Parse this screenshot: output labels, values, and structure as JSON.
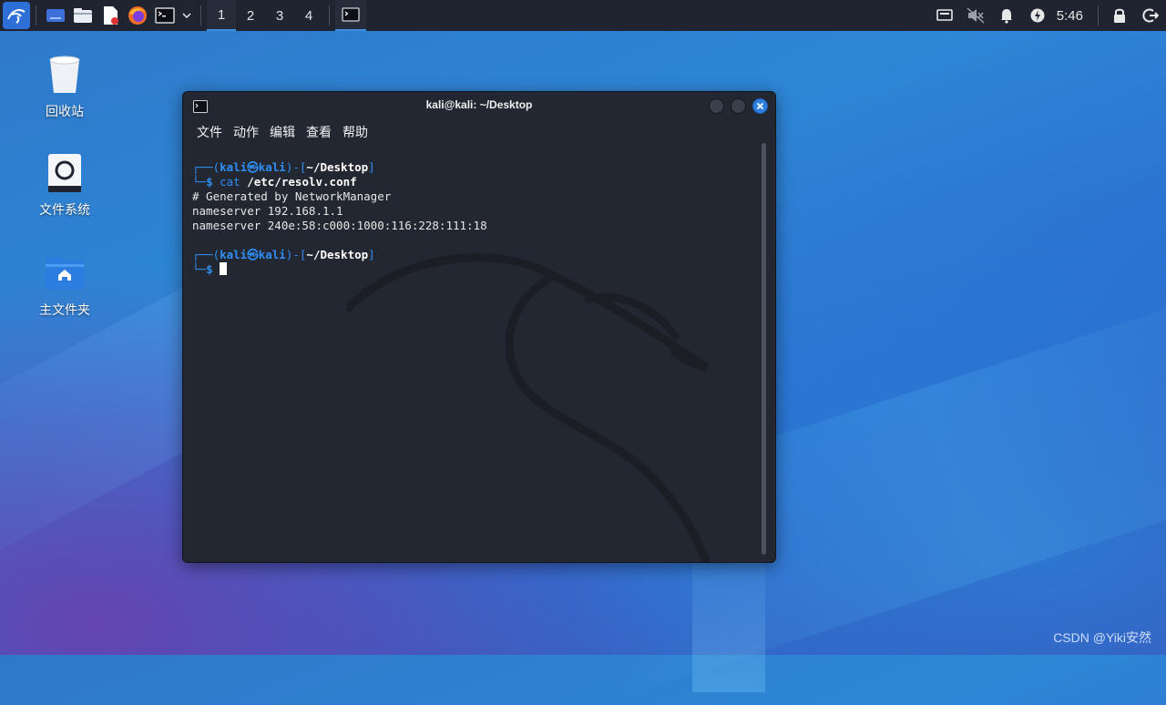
{
  "taskbar": {
    "workspaces": [
      "1",
      "2",
      "3",
      "4"
    ],
    "active_workspace": "1",
    "clock": "5:46",
    "icons": [
      "kali-menu-icon",
      "show-desktop-icon",
      "file-manager-icon",
      "text-editor-icon",
      "firefox-icon",
      "terminal-icon",
      "chevron-down-icon",
      "network-icon",
      "mute-icon",
      "bell-icon",
      "power-icon",
      "lock-icon",
      "logout-icon"
    ]
  },
  "desktop": {
    "icons": [
      {
        "label": "回收站",
        "icon": "trash-icon"
      },
      {
        "label": "文件系统",
        "icon": "drive-icon"
      },
      {
        "label": "主文件夹",
        "icon": "home-folder-icon"
      }
    ]
  },
  "terminal": {
    "title": "kali@kali: ~/Desktop",
    "menu": [
      "文件",
      "动作",
      "编辑",
      "查看",
      "帮助"
    ],
    "prompt1": {
      "open": "┌──(",
      "user": "kali",
      "at": "㉿",
      "host": "kali",
      "mid": ")-[",
      "path": "~/Desktop",
      "close": "]"
    },
    "prompt1_line2": {
      "corner": "└─",
      "dollar": "$",
      "cmd": "cat",
      "arg": "/etc/resolv.conf"
    },
    "output": [
      "# Generated by NetworkManager",
      "nameserver 192.168.1.1",
      "nameserver 240e:58:c000:1000:116:228:111:18"
    ],
    "prompt2": {
      "open": "┌──(",
      "user": "kali",
      "at": "㉿",
      "host": "kali",
      "mid": ")-[",
      "path": "~/Desktop",
      "close": "]"
    },
    "prompt2_line2": {
      "corner": "└─",
      "dollar": "$"
    }
  },
  "watermark": "CSDN @Yiki安然",
  "colors": {
    "accent": "#2f8ff5",
    "terminal_bg": "#232731",
    "taskbar_bg": "#1f2430"
  }
}
